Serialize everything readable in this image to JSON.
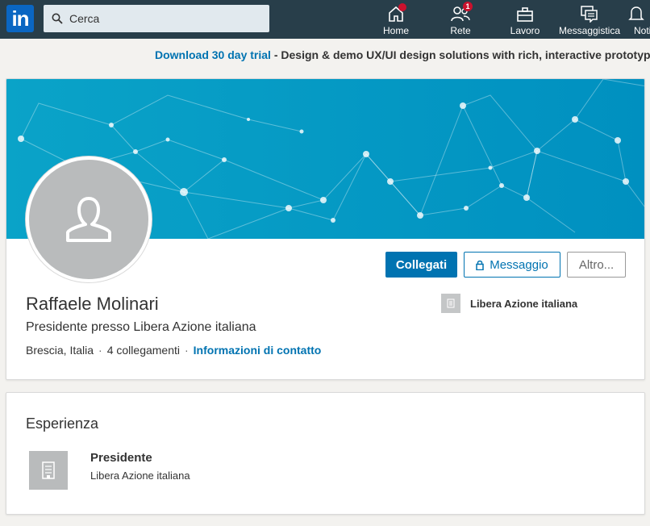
{
  "colors": {
    "topbar": "#283e4a",
    "accent": "#0073b1",
    "notification": "#cb112d",
    "cover_gradient_start": "#0aa3c8",
    "cover_gradient_end": "#0090c0"
  },
  "header": {
    "logo_text": "in",
    "search": {
      "placeholder": "Cerca"
    },
    "nav": [
      {
        "label": "Home",
        "icon": "home-icon",
        "badge": ""
      },
      {
        "label": "Rete",
        "icon": "network-icon",
        "badge": "1"
      },
      {
        "label": "Lavoro",
        "icon": "briefcase-icon",
        "badge": ""
      },
      {
        "label": "Messaggistica",
        "icon": "messaging-icon",
        "badge": ""
      },
      {
        "label": "Notifiche",
        "icon": "bell-icon",
        "badge": ""
      }
    ]
  },
  "ad_banner": {
    "link_text": "Download 30 day trial",
    "separator": " - ",
    "text": "Design & demo UX/UI design solutions with rich, interactive prototypes"
  },
  "profile": {
    "name": "Raffaele Molinari",
    "headline": "Presidente presso Libera Azione italiana",
    "location": "Brescia, Italia",
    "connections": "4 collegamenti",
    "contact_link": "Informazioni di contatto",
    "company": "Libera Azione italiana",
    "actions": {
      "connect": "Collegati",
      "message": "Messaggio",
      "more": "Altro..."
    }
  },
  "experience": {
    "title": "Esperienza",
    "items": [
      {
        "role": "Presidente",
        "company": "Libera Azione italiana"
      }
    ]
  }
}
